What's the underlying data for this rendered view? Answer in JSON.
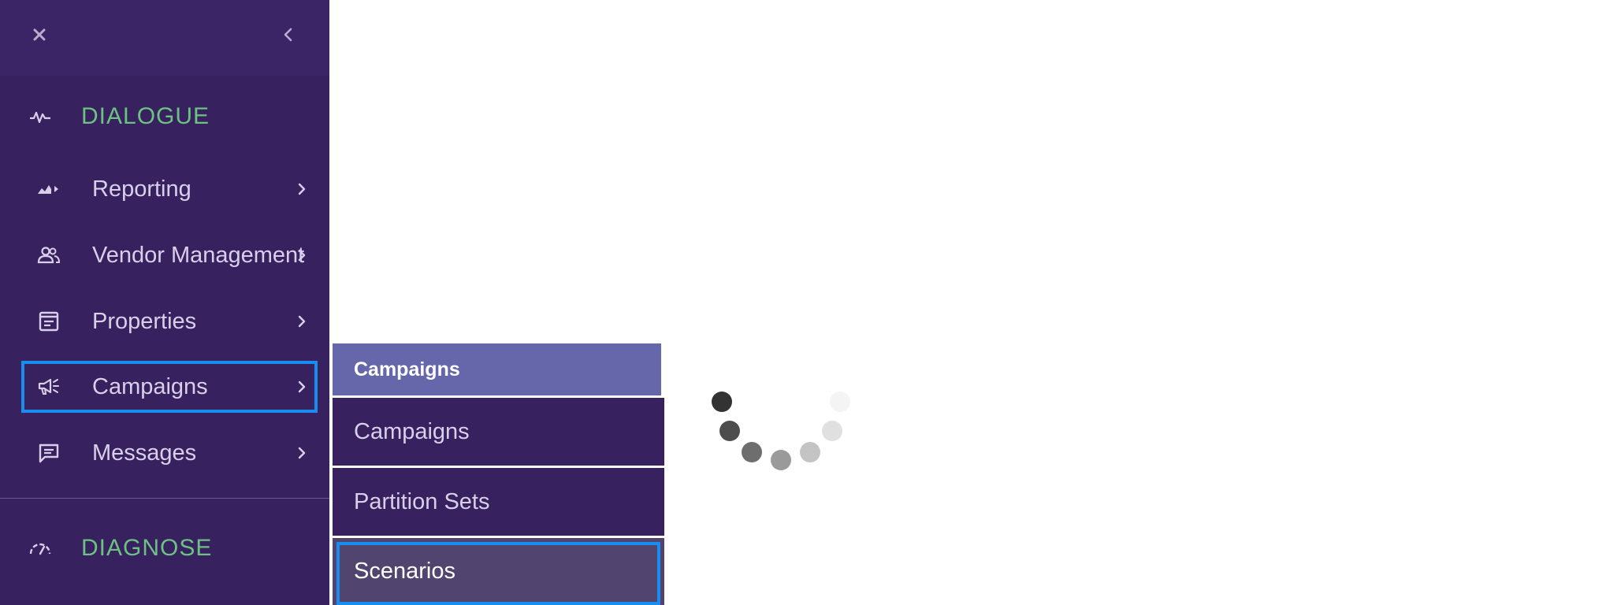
{
  "sidebar": {
    "close_icon": "close-icon",
    "collapse_icon": "chevron-left-icon",
    "sections": [
      {
        "label": "DIALOGUE",
        "icon": "activity-icon"
      },
      {
        "label": "DIAGNOSE",
        "icon": "gauge-icon"
      }
    ],
    "items": [
      {
        "label": "Reporting",
        "icon": "chart-icon"
      },
      {
        "label": "Vendor Management",
        "icon": "people-icon"
      },
      {
        "label": "Properties",
        "icon": "document-icon"
      },
      {
        "label": "Campaigns",
        "icon": "megaphone-icon"
      },
      {
        "label": "Messages",
        "icon": "message-icon"
      }
    ],
    "focused_item": "Campaigns"
  },
  "submenu": {
    "header": "Campaigns",
    "items": [
      "Campaigns",
      "Partition Sets",
      "Scenarios"
    ],
    "selected": "Scenarios"
  },
  "colors": {
    "sidebar_bg": "#37215f",
    "section_label": "#6cc183",
    "submenu_header": "#6667aa",
    "focus_ring": "#1a8df0",
    "selected_bg": "#51456f"
  },
  "loading_spinner": "loading-spinner"
}
